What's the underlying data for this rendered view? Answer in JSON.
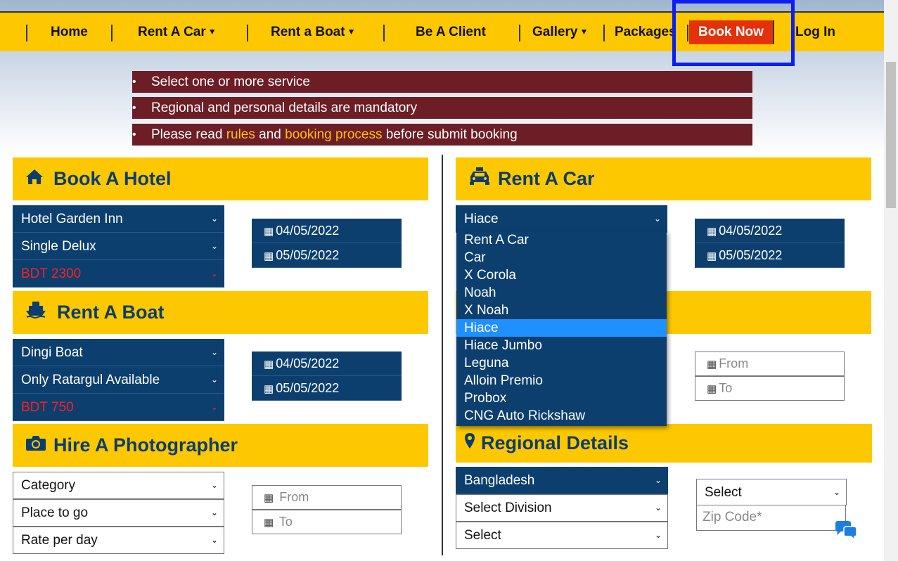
{
  "nav": {
    "items": [
      "Home",
      "Rent A Car",
      "Rent a Boat",
      "Be A Client",
      "Gallery",
      "Packages",
      "Book Now",
      "Log In"
    ]
  },
  "notices": {
    "line1": "Select one or more service",
    "line2": "Regional and personal details are mandatory",
    "line3_pre": "Please read ",
    "line3_rules": "rules",
    "line3_and": " and ",
    "line3_process": "booking process",
    "line3_post": " before submit booking"
  },
  "hotel": {
    "title": "Book A Hotel",
    "hotel_name": "Hotel Garden Inn",
    "room": "Single Delux",
    "price": "BDT 2300",
    "date_from": "04/05/2022",
    "date_to": "05/05/2022"
  },
  "car": {
    "title": "Rent A Car",
    "selected": "Hiace",
    "date_from": "04/05/2022",
    "date_to": "05/05/2022",
    "options": [
      "Rent A Car",
      "Car",
      "X Corola",
      "Noah",
      "X Noah",
      "Hiace",
      "Hiace Jumbo",
      "Leguna",
      "Alloin Premio",
      "Probox",
      "CNG Auto Rickshaw"
    ],
    "extra_from_placeholder": "From",
    "extra_to_placeholder": "To"
  },
  "boat": {
    "title": "Rent A Boat",
    "boat_type": "Dingi Boat",
    "location": "Only Ratargul Available",
    "price": "BDT 750",
    "date_from": "04/05/2022",
    "date_to": "05/05/2022"
  },
  "photographer": {
    "title": "Hire A Photographer",
    "category": "Category",
    "place": "Place to go",
    "rate": "Rate per day",
    "from_placeholder": "From",
    "to_placeholder": "To"
  },
  "regional": {
    "title": "Regional Details",
    "country": "Bangladesh",
    "division": "Select Division",
    "district": "Select",
    "area": "Select",
    "zip_placeholder": "Zip Code*"
  },
  "colors": {
    "nav_bg": "#fdc800",
    "notice_bg": "#6d1d25",
    "select_bg": "#0c3f6e",
    "book_now_bg": "#e3310c",
    "highlight": "#0a1ff2"
  }
}
